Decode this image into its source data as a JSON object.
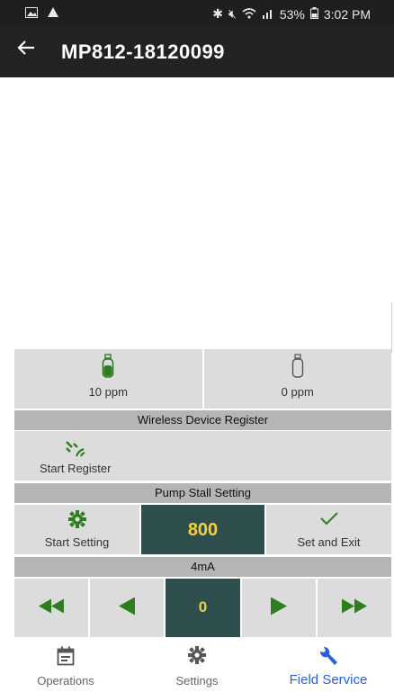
{
  "status_bar": {
    "left_icons": [
      "image-icon",
      "warning-icon"
    ],
    "right_icons": [
      "bluetooth-icon",
      "mute-icon",
      "wifi-icon",
      "signal-icon"
    ],
    "battery": "53%",
    "time": "3:02 PM"
  },
  "app_bar": {
    "back_icon": "arrow-left-icon",
    "title": "MP812-18120099"
  },
  "gas": [
    {
      "icon": "gas-cylinder-filled-icon",
      "value": "10 ppm"
    },
    {
      "icon": "gas-cylinder-empty-icon",
      "value": "0 ppm"
    }
  ],
  "wireless": {
    "header": "Wireless Device Register",
    "start_label": "Start Register"
  },
  "pump": {
    "header": "Pump Stall Setting",
    "start_label": "Start Setting",
    "value": "800",
    "set_exit_label": "Set and Exit"
  },
  "current": {
    "header": "4mA",
    "value": "0"
  },
  "tabs": {
    "operations": "Operations",
    "settings": "Settings",
    "field_service": "Field Service"
  },
  "colors": {
    "accent_green": "#2e7d1e",
    "value_bg": "#2f4f4f",
    "value_text": "#f4d03f",
    "active_tab": "#2b5fd9"
  }
}
